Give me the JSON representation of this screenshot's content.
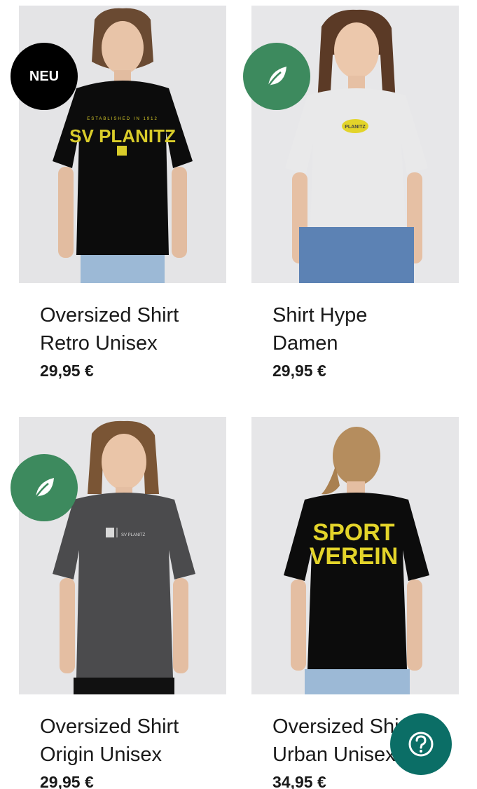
{
  "products": [
    {
      "title_line1": "Oversized Shirt",
      "title_line2": "Retro Unisex",
      "price": "29,95 €",
      "badge": "NEU",
      "shirt_color": "#0c0c0c",
      "print_text": "SV PLANITZ",
      "print_small": "ESTABLISHED IN 1912"
    },
    {
      "title_line1": "Shirt Hype",
      "title_line2": "Damen",
      "price": "29,95 €",
      "badge": "leaf-icon",
      "shirt_color": "#e9e9ea",
      "print_text": "PLANITZ"
    },
    {
      "title_line1": "Oversized Shirt",
      "title_line2": "Origin Unisex",
      "price": "29,95 €",
      "badge": "leaf-icon",
      "shirt_color": "#4b4b4d",
      "print_text": "SV PLANITZ"
    },
    {
      "title_line1": "Oversized Shirt",
      "title_line2": "Urban Unisex",
      "price": "34,95 €",
      "badge": "",
      "shirt_color": "#0c0c0c",
      "print_text_1": "SPORT",
      "print_text_2": "VEREIN"
    }
  ],
  "colors": {
    "eco_badge": "#3d8a5e",
    "help_button": "#0b6e66",
    "print_yellow": "#e3d42a"
  },
  "help_button": {
    "icon": "question-icon"
  }
}
